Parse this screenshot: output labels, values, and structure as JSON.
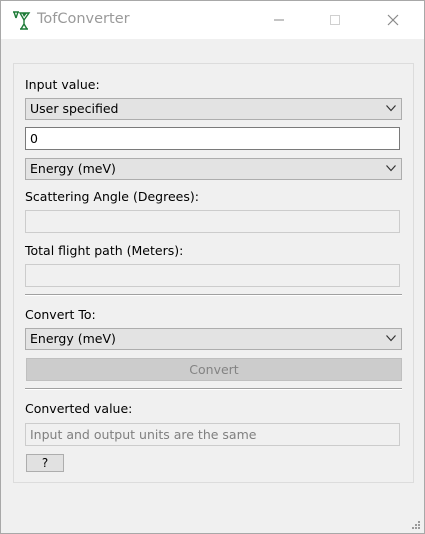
{
  "window": {
    "title": "TofConverter",
    "app_icon": "beaker-logo-icon",
    "controls": [
      "minimize-icon",
      "maximize-icon",
      "close-icon"
    ]
  },
  "input": {
    "section_label": "Input value:",
    "mode_selected": "User specified",
    "value": "0",
    "unit_selected": "Energy (meV)"
  },
  "scattering_angle": {
    "label": "Scattering Angle (Degrees):",
    "value": ""
  },
  "flight_path": {
    "label": "Total flight path (Meters):",
    "value": ""
  },
  "convert_to": {
    "label": "Convert To:",
    "unit_selected": "Energy (meV)",
    "button_label": "Convert"
  },
  "output": {
    "label": "Converted value:",
    "value": "Input and output units are the same"
  },
  "help_button_label": "?",
  "colors": {
    "accent_icon": "#1c7a36",
    "disabled_text": "#7f7f7f"
  }
}
